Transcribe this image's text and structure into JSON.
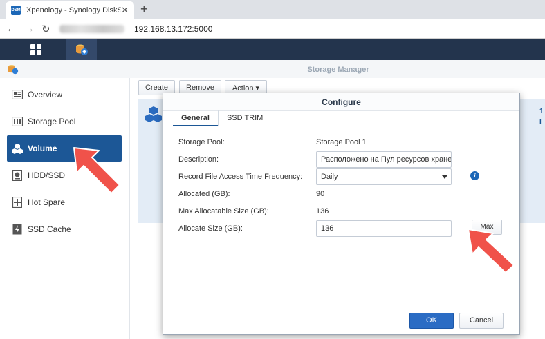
{
  "browser": {
    "tab_title": "Xpenology - Synology DiskStation",
    "favicon_text": "DSM",
    "url": "192.168.13.172:5000",
    "new_tab_label": "+",
    "close_label": "✕"
  },
  "app": {
    "title": "Storage Manager"
  },
  "sidebar": {
    "items": [
      {
        "label": "Overview",
        "icon": "overview-icon"
      },
      {
        "label": "Storage Pool",
        "icon": "storage-pool-icon"
      },
      {
        "label": "Volume",
        "icon": "volume-icon",
        "active": true
      },
      {
        "label": "HDD/SSD",
        "icon": "hdd-icon"
      },
      {
        "label": "Hot Spare",
        "icon": "hot-spare-icon"
      },
      {
        "label": "SSD Cache",
        "icon": "ssd-cache-icon"
      }
    ]
  },
  "toolbar": {
    "create_label": "Create",
    "remove_label": "Remove",
    "action_label": "Action ▾"
  },
  "volume_panel": {
    "side_text_1": "1",
    "side_text_2": "I"
  },
  "dialog": {
    "title": "Configure",
    "tabs": [
      "General",
      "SSD TRIM"
    ],
    "fields": {
      "storage_pool_label": "Storage Pool:",
      "storage_pool_value": "Storage Pool 1",
      "description_label": "Description:",
      "description_value": "Расположено на Пул ресурсов хранен",
      "record_label": "Record File Access Time Frequency:",
      "record_value": "Daily",
      "allocated_label": "Allocated (GB):",
      "allocated_value": "90",
      "max_alloc_label": "Max Allocatable Size (GB):",
      "max_alloc_value": "136",
      "alloc_size_label": "Allocate Size (GB):",
      "alloc_size_value": "136"
    },
    "max_label": "Max",
    "ok_label": "OK",
    "cancel_label": "Cancel",
    "info_glyph": "i"
  },
  "colors": {
    "accent": "#1c5796",
    "taskbar": "#23344d",
    "ok_button": "#2b6cc4",
    "annotation_arrow": "#f0524a"
  }
}
